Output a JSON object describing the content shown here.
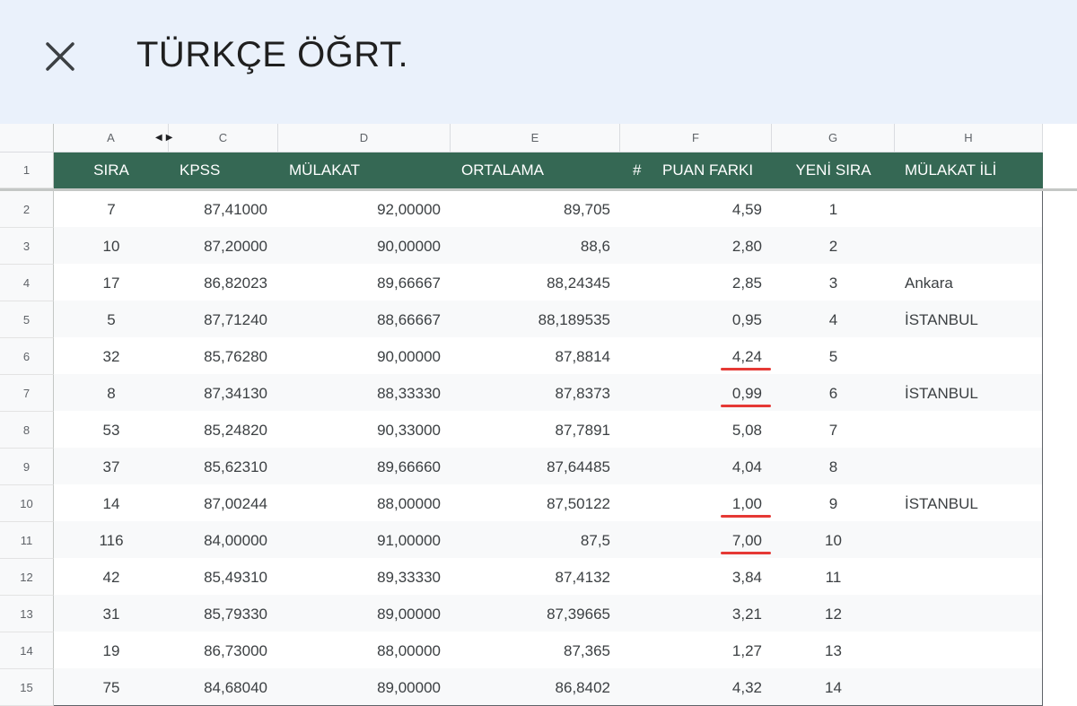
{
  "app": {
    "title": "TÜRKÇE ÖĞRT."
  },
  "columns": [
    "A",
    "C",
    "D",
    "E",
    "F",
    "G",
    "H"
  ],
  "headers": {
    "sira": "SIRA",
    "kpss": "KPSS",
    "mulakat": "MÜLAKAT",
    "ortalama": "ORTALAMA",
    "hash": "#",
    "puan_farki": "PUAN FARKI",
    "yeni_sira": "YENİ SIRA",
    "mulakat_ili": "MÜLAKAT İLİ"
  },
  "row_numbers": [
    "1",
    "2",
    "3",
    "4",
    "5",
    "6",
    "7",
    "8",
    "9",
    "10",
    "11",
    "12",
    "13",
    "14",
    "15"
  ],
  "rows": [
    {
      "sira": "7",
      "kpss": "87,41000",
      "mulakat": "92,00000",
      "ortalama": "89,705",
      "fark": "4,59",
      "yeni": "1",
      "il": ""
    },
    {
      "sira": "10",
      "kpss": "87,20000",
      "mulakat": "90,00000",
      "ortalama": "88,6",
      "fark": "2,80",
      "yeni": "2",
      "il": ""
    },
    {
      "sira": "17",
      "kpss": "86,82023",
      "mulakat": "89,66667",
      "ortalama": "88,24345",
      "fark": "2,85",
      "yeni": "3",
      "il": "Ankara"
    },
    {
      "sira": "5",
      "kpss": "87,71240",
      "mulakat": "88,66667",
      "ortalama": "88,189535",
      "fark": "0,95",
      "yeni": "4",
      "il": "İSTANBUL"
    },
    {
      "sira": "32",
      "kpss": "85,76280",
      "mulakat": "90,00000",
      "ortalama": "87,8814",
      "fark": "4,24",
      "yeni": "5",
      "il": ""
    },
    {
      "sira": "8",
      "kpss": "87,34130",
      "mulakat": "88,33330",
      "ortalama": "87,8373",
      "fark": "0,99",
      "yeni": "6",
      "il": "İSTANBUL"
    },
    {
      "sira": "53",
      "kpss": "85,24820",
      "mulakat": "90,33000",
      "ortalama": "87,7891",
      "fark": "5,08",
      "yeni": "7",
      "il": ""
    },
    {
      "sira": "37",
      "kpss": "85,62310",
      "mulakat": "89,66660",
      "ortalama": "87,64485",
      "fark": "4,04",
      "yeni": "8",
      "il": ""
    },
    {
      "sira": "14",
      "kpss": "87,00244",
      "mulakat": "88,00000",
      "ortalama": "87,50122",
      "fark": "1,00",
      "yeni": "9",
      "il": "İSTANBUL"
    },
    {
      "sira": "116",
      "kpss": "84,00000",
      "mulakat": "91,00000",
      "ortalama": "87,5",
      "fark": "7,00",
      "yeni": "10",
      "il": ""
    },
    {
      "sira": "42",
      "kpss": "85,49310",
      "mulakat": "89,33330",
      "ortalama": "87,4132",
      "fark": "3,84",
      "yeni": "11",
      "il": ""
    },
    {
      "sira": "31",
      "kpss": "85,79330",
      "mulakat": "89,00000",
      "ortalama": "87,39665",
      "fark": "3,21",
      "yeni": "12",
      "il": ""
    },
    {
      "sira": "19",
      "kpss": "86,73000",
      "mulakat": "88,00000",
      "ortalama": "87,365",
      "fark": "1,27",
      "yeni": "13",
      "il": ""
    },
    {
      "sira": "75",
      "kpss": "84,68040",
      "mulakat": "89,00000",
      "ortalama": "86,8402",
      "fark": "4,32",
      "yeni": "14",
      "il": ""
    }
  ],
  "underlined_fark_values": [
    "4,24",
    "0,99",
    "1,00",
    "7,00"
  ],
  "colors": {
    "header_green": "#356854",
    "topbar": "#eaf1fb",
    "underline_red": "#e53935",
    "row_alt": "#f8f9fa"
  }
}
